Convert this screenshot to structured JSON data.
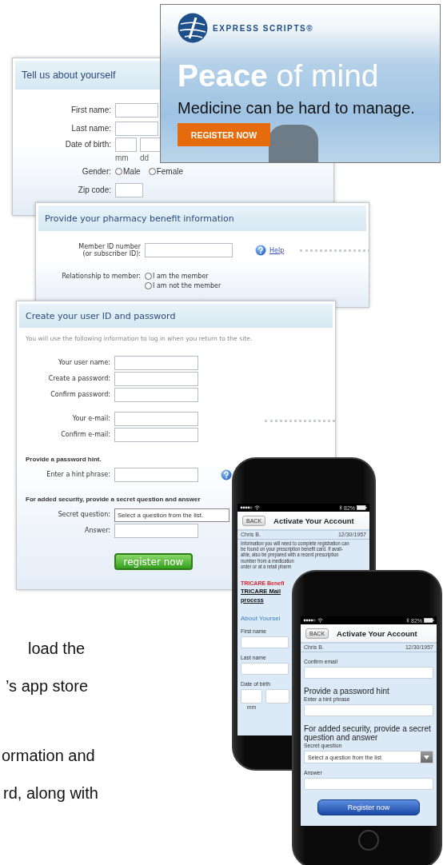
{
  "banner": {
    "brand": "EXPRESS SCRIPTS®",
    "headline": "**Peace** of mind",
    "tagline": "Medicine can be hard to manage.",
    "button": "REGISTER NOW"
  },
  "about_panel": {
    "title": "Tell us about yourself",
    "groups": [
      [
        {
          "kind": "field",
          "label": "First name:"
        },
        {
          "kind": "field",
          "label": "Last name:"
        },
        {
          "kind": "date",
          "label": "Date of birth:",
          "parts": [
            "mm",
            "dd"
          ]
        },
        {
          "kind": "radio",
          "label": "Gender:",
          "options": [
            {
              "label": "Male",
              "selected": false
            },
            {
              "label": "Female",
              "selected": false
            }
          ]
        },
        {
          "kind": "short_field",
          "label": "Zip code:"
        }
      ]
    ]
  },
  "benefit_panel": {
    "title": "Provide your pharmacy benefit information",
    "groups": [
      [
        {
          "kind": "help_field",
          "label": "Member ID number\n(or subscriber ID):",
          "help": "Help"
        }
      ],
      [
        {
          "kind": "radio",
          "label": "Relationship to member:",
          "options": [
            {
              "label": "I am the member",
              "selected": false
            },
            {
              "label": "I am not the member",
              "selected": false
            }
          ]
        }
      ]
    ]
  },
  "account_panel": {
    "title": "Create your user ID and password",
    "intro": "You will use the following information to log in when you return to the site.",
    "groups": [
      [
        {
          "kind": "field",
          "label": "Your user name:"
        },
        {
          "kind": "field",
          "label": "Create a password:"
        },
        {
          "kind": "field",
          "label": "Confirm password:"
        }
      ],
      [
        {
          "kind": "field",
          "label": "Your e-mail:"
        },
        {
          "kind": "field",
          "label": "Confirm e-mail:"
        }
      ],
      [
        {
          "kind": "heading",
          "text": "Provide a password hint."
        },
        {
          "kind": "help_field",
          "label": "Enter a hint phrase:"
        }
      ],
      [
        {
          "kind": "heading",
          "text": "For added security, provide a secret question and answer"
        },
        {
          "kind": "select",
          "label": "Secret question:",
          "value": "Select a question from the list."
        },
        {
          "kind": "field",
          "label": "Answer:"
        }
      ]
    ],
    "button": "register now"
  },
  "phones": [
    {
      "battery": "82%",
      "back": "BACK",
      "title": "Activate Your Account",
      "user": "Chris B.",
      "date": "12/30/1957",
      "items": [
        {
          "kind": "note",
          "text": "Information you will need to complete registration can\nbe found on your prescription benefit card. If avail-\nable, also be prepared with a recent prescription\nnumber from a medication\norder or at a retail pharm"
        },
        {
          "kind": "alert",
          "text": "TRICARE Benefi"
        },
        {
          "kind": "link",
          "text": "TRICARE Mail"
        },
        {
          "kind": "link",
          "text": "process"
        },
        {
          "kind": "section",
          "text": "About Yoursel"
        },
        {
          "kind": "field",
          "label": "First name"
        },
        {
          "kind": "field",
          "label": "Last name"
        },
        {
          "kind": "date",
          "label": "Date of birth",
          "parts": [
            "mm"
          ]
        }
      ]
    },
    {
      "battery": "82%",
      "back": "BACK",
      "title": "Activate Your Account",
      "user": "Chris B.",
      "date": "12/30/1957",
      "items": [
        {
          "kind": "field",
          "label": "Confirm email"
        },
        {
          "kind": "heading",
          "text": "Provide a password hint"
        },
        {
          "kind": "field",
          "label": "Enter a hint phrase"
        },
        {
          "kind": "heading",
          "text": "For added security, provide a secret question and answer"
        },
        {
          "kind": "select",
          "label": "Secret question",
          "value": "Select a question from the list"
        },
        {
          "kind": "field",
          "label": "Answer"
        }
      ],
      "button": "Register now"
    }
  ],
  "doc_lines": [
    "load the",
    "’s app store",
    "ormation and",
    "rd, along with"
  ]
}
